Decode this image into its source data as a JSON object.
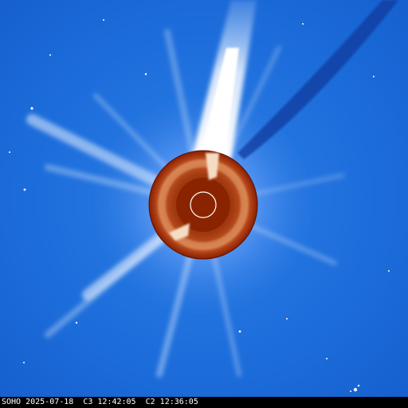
{
  "image": {
    "kind": "composite coronagraph view",
    "caption": "SOHO 2025-07-18  C3 12:42:05  C2 12:36:05"
  },
  "colors": {
    "background_blue": "#1a6ad8",
    "corona_white": "#ffffff",
    "occulter_dark_red": "#8a1e00",
    "occulter_mid_red": "#c0501c",
    "occulter_light": "#f0d2b0"
  }
}
